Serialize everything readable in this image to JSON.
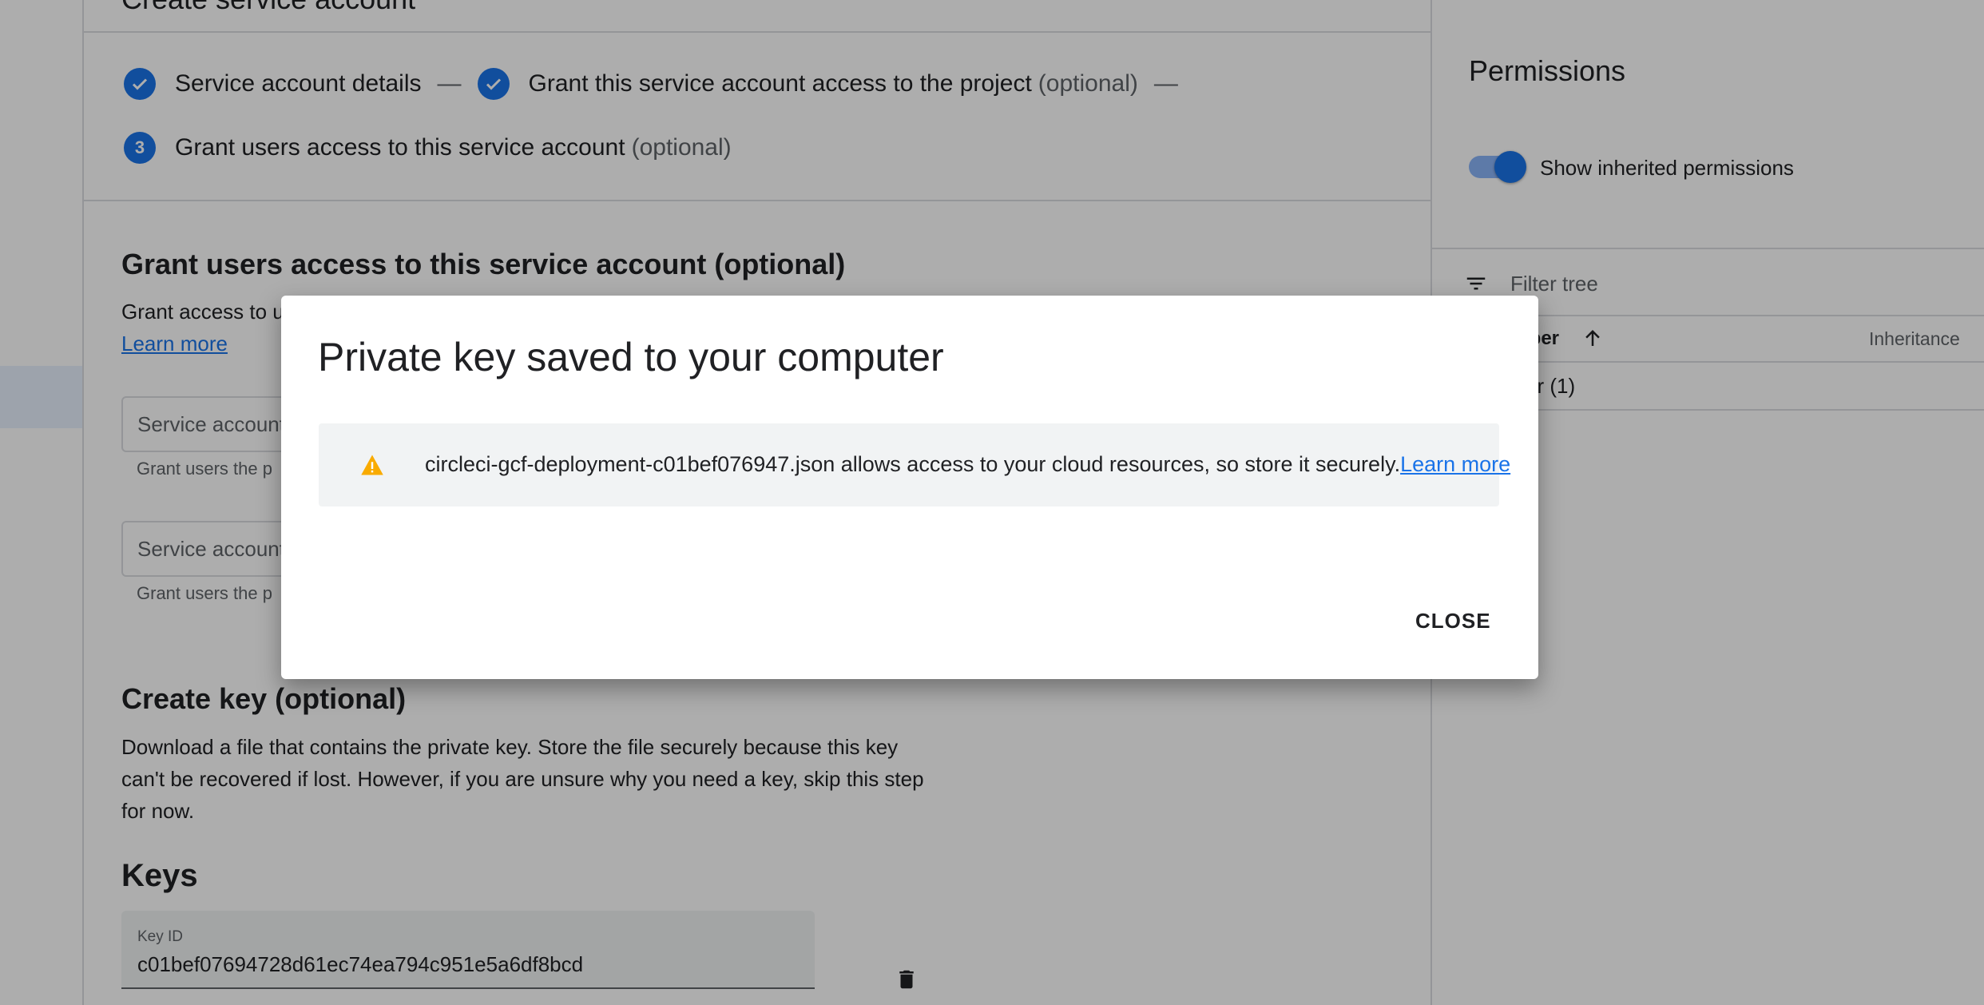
{
  "page": {
    "title": "Create service account"
  },
  "stepper": {
    "step1_label": "Service account details",
    "step2_label": "Grant this service account access to the project",
    "step2_optional": "(optional)",
    "step3_number": "3",
    "step3_label": "Grant users access to this service account",
    "step3_optional": "(optional)"
  },
  "grant_section": {
    "heading": "Grant users access to this service account (optional)",
    "description_prefix": "Grant access to u",
    "learn_more": "Learn more",
    "field1_label": "Service account",
    "field1_hint": "Grant users the p",
    "field2_label": "Service account",
    "field2_hint": "Grant users the p"
  },
  "create_key": {
    "heading": "Create key (optional)",
    "description_line1": "Download a file that contains the private key. Store the file securely because this key",
    "description_line2": "can't be recovered if lost. However, if you are unsure why you need a key, skip this step",
    "description_line3": "for now.",
    "keys_heading": "Keys",
    "key_id_label": "Key ID",
    "key_id_value": "c01bef07694728d61ec74ea794c951e5a6df8bcd"
  },
  "permissions_panel": {
    "title": "Permissions",
    "toggle_label": "Show inherited permissions",
    "toggle_on": true,
    "filter_placeholder": "Filter tree",
    "col_member": "nber",
    "col_inheritance": "Inheritance",
    "row1": "er (1)"
  },
  "dialog": {
    "title": "Private key saved to your computer",
    "warning_text": "circleci-gcf-deployment-c01bef076947.json allows access to your cloud resources, so store it securely.",
    "learn_more": "Learn more",
    "close_label": "CLOSE"
  },
  "colors": {
    "accent": "#1a73e8",
    "warning": "#f9ab00",
    "scrim": "rgba(0,0,0,0.32)"
  },
  "icons": [
    "check-icon",
    "filter-icon",
    "arrow-up-icon",
    "warning-icon",
    "delete-icon"
  ]
}
